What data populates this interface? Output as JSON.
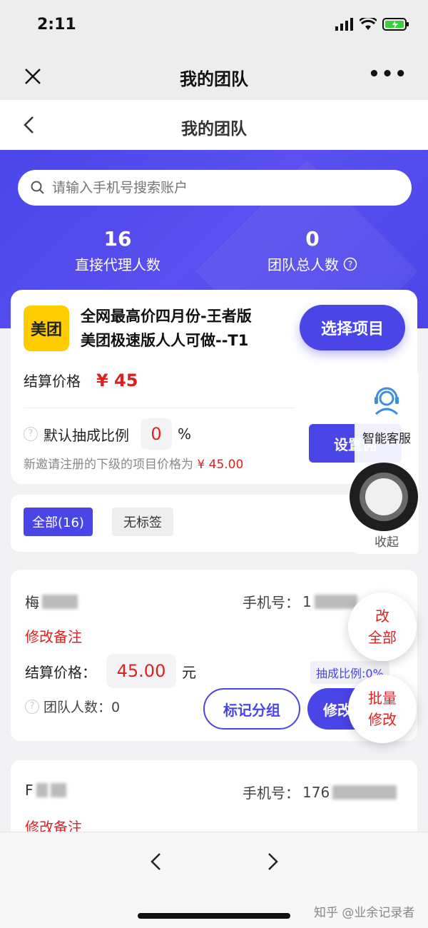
{
  "status": {
    "time": "2:11"
  },
  "wechat": {
    "title": "我的团队",
    "more": "•••"
  },
  "page": {
    "title": "我的团队"
  },
  "search": {
    "placeholder": "请输入手机号搜索账户"
  },
  "stats": [
    {
      "value": "16",
      "label": "直接代理人数"
    },
    {
      "value": "0",
      "label": "团队总人数"
    }
  ],
  "project": {
    "logo": "美团",
    "name_line1": "全网最高价四月份-王者版",
    "name_line2": "美团极速版人人可做--T1",
    "select_label": "选择项目",
    "price_label": "结算价格",
    "price_value": "¥ 45",
    "rate_label": "默认抽成比例",
    "rate_value": "0",
    "rate_unit": "%",
    "set_label": "设置佣",
    "note_prefix": "新邀请注册的下级的项目价格为 ",
    "note_value": "¥ 45.00"
  },
  "filters": [
    {
      "label": "全部(16)",
      "active": true
    },
    {
      "label": "无标签",
      "active": false
    }
  ],
  "side": {
    "service_label": "智能客服",
    "collapse_label": "收起"
  },
  "members": [
    {
      "name": "梅",
      "phone_label": "手机号：",
      "phone_value": "1",
      "remark": "修改备注",
      "price_label": "结算价格：",
      "price_value": "45.00",
      "price_unit": "元",
      "rate_tag": "抽成比例:0%",
      "team_label": "团队人数：0",
      "mark_label": "标记分组",
      "edit_label": "修改"
    },
    {
      "name": "F",
      "phone_label": "手机号：",
      "phone_value": "176",
      "remark": "修改备注"
    }
  ],
  "floating": {
    "edit_all_l1": "改",
    "edit_all_l2": "全部",
    "batch_l1": "批量",
    "batch_l2": "修改"
  },
  "watermark": "知乎 @业余记录者",
  "colors": {
    "accent": "#4a45e6",
    "price": "#e02020",
    "brand": "#ffcc00"
  }
}
